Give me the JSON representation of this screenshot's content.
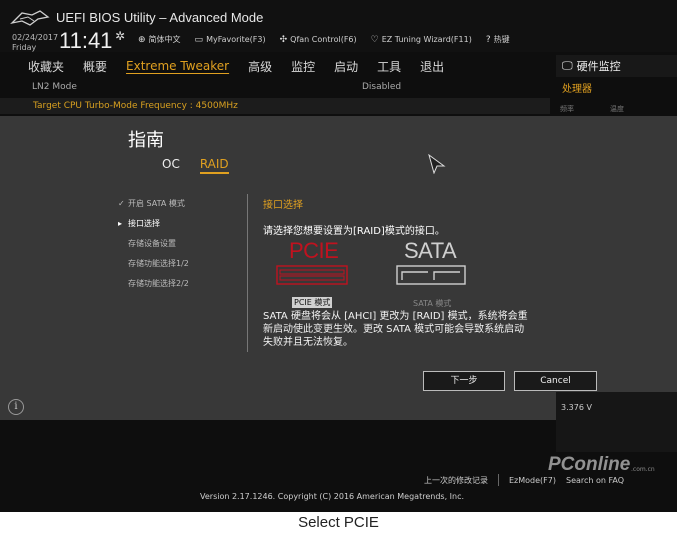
{
  "header": {
    "app_title": "UEFI BIOS Utility – Advanced Mode",
    "date": "02/24/2017",
    "day": "Friday",
    "time": "11:41",
    "toolbar": [
      {
        "icon": "globe-icon",
        "label": "简体中文"
      },
      {
        "icon": "favorite-icon",
        "label": "MyFavorite(F3)"
      },
      {
        "icon": "fan-icon",
        "label": "Qfan Control(F6)"
      },
      {
        "icon": "bulb-icon",
        "label": "EZ Tuning Wizard(F11)"
      },
      {
        "icon": "help-icon",
        "label": "热键"
      }
    ]
  },
  "menu": {
    "items": [
      "收藏夹",
      "概要",
      "Extreme Tweaker",
      "高级",
      "监控",
      "启动",
      "工具",
      "退出"
    ],
    "active": "Extreme Tweaker"
  },
  "settings": {
    "row1_label": "LN2 Mode",
    "row1_value": "Disabled",
    "row2_label": "Target CPU Turbo-Mode Frequency : 4500MHz"
  },
  "hw_monitor": {
    "title": "硬件监控",
    "section": "处理器",
    "col1": "频率",
    "col2": "温度",
    "voltage": "3.376 V"
  },
  "dialog": {
    "title": "指南",
    "tabs": [
      {
        "label": "OC",
        "active": false
      },
      {
        "label": "RAID",
        "active": true
      }
    ],
    "steps": [
      {
        "mark": "✓",
        "label": "开启 SATA 模式",
        "state": "done"
      },
      {
        "mark": "▸",
        "label": "接口选择",
        "state": "current"
      },
      {
        "mark": "",
        "label": "存储设备设置",
        "state": "pending"
      },
      {
        "mark": "",
        "label": "存储功能选择1/2",
        "state": "pending"
      },
      {
        "mark": "",
        "label": "存储功能选择2/2",
        "state": "pending"
      }
    ],
    "heading": "接口选择",
    "prompt": "请选择您想要设置为[RAID]模式的接口。",
    "option_pcie_name": "PCIE",
    "option_pcie_label": "PCIE 模式",
    "option_sata_name": "SATA",
    "option_sata_label": "SATA 模式",
    "description": "SATA 硬盘将会从 [AHCI] 更改为 [RAID] 模式，系统将会重新启动使此变更生效。更改 SATA 模式可能会导致系统启动失败并且无法恢复。",
    "next_button": "下一步",
    "cancel_button": "Cancel",
    "accent_color": "#e0a020",
    "pcie_color": "#c0121f"
  },
  "footer": {
    "last_modified": "上一次的修改记录",
    "ezmode": "EzMode(F7)",
    "search": "Search on FAQ",
    "version": "Version 2.17.1246. Copyright (C) 2016 American Megatrends, Inc."
  },
  "watermark": {
    "brand": "PConline",
    "domain": ".com.cn"
  },
  "caption": "Select PCIE"
}
